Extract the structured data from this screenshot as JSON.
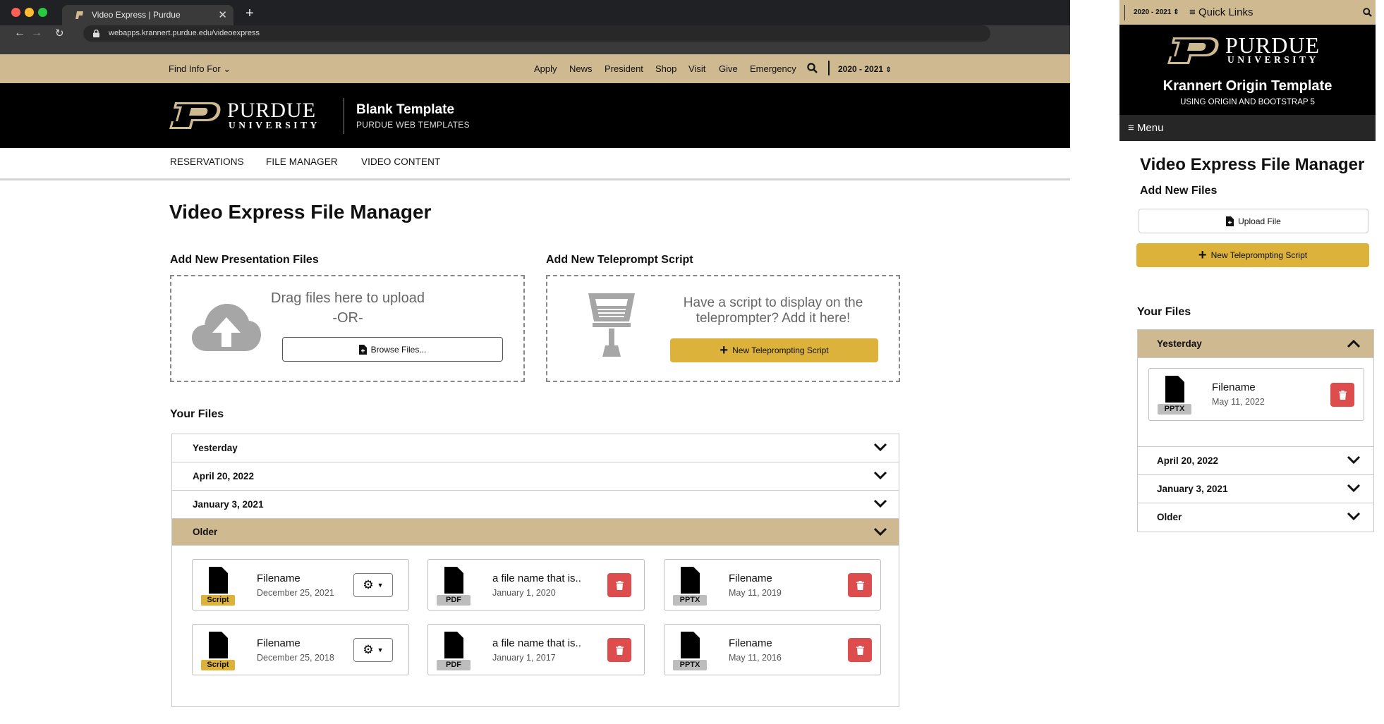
{
  "browser": {
    "tab_title": "Video Express | Purdue",
    "url": "webapps.krannert.purdue.edu/videoexpress"
  },
  "utility_bar": {
    "find_info": "Find Info For",
    "links": [
      "Apply",
      "News",
      "President",
      "Shop",
      "Visit",
      "Give",
      "Emergency"
    ],
    "year": "2020 - 2021"
  },
  "brand": {
    "wordmark_top": "PURDUE",
    "wordmark_bottom": "UNIVERSITY",
    "site_title": "Blank Template",
    "site_subtitle": "PURDUE WEB TEMPLATES"
  },
  "subnav": [
    "RESERVATIONS",
    "FILE MANAGER",
    "VIDEO CONTENT"
  ],
  "page_title": "Video Express File Manager",
  "presentation": {
    "heading": "Add New Presentation Files",
    "drag_text_1": "Drag files here to upload",
    "drag_text_2": "-OR-",
    "browse_label": "Browse Files..."
  },
  "teleprompt": {
    "heading": "Add New Teleprompt Script",
    "prompt_1": "Have a script to display on the",
    "prompt_2": "teleprompter? Add it here!",
    "new_label": "New Teleprompting Script"
  },
  "files": {
    "heading": "Your Files",
    "groups": [
      "Yesterday",
      "April 20, 2022",
      "January 3, 2021",
      "Older"
    ],
    "cards": [
      {
        "type": "Script",
        "name": "Filename",
        "date": "December 25, 2021"
      },
      {
        "type": "PDF",
        "name": "a file name that is..",
        "date": "January 1, 2020"
      },
      {
        "type": "PPTX",
        "name": "Filename",
        "date": "May 11, 2019"
      },
      {
        "type": "Script",
        "name": "Filename",
        "date": "December 25, 2018"
      },
      {
        "type": "PDF",
        "name": "a file name that is..",
        "date": "January 1, 2017"
      },
      {
        "type": "PPTX",
        "name": "Filename",
        "date": "May 11, 2016"
      }
    ]
  },
  "mobile": {
    "year": "2020 - 2021",
    "quick_links": "Quick Links",
    "wordmark_top": "PURDUE",
    "wordmark_bottom": "UNIVERSITY",
    "site_title": "Krannert Origin Template",
    "site_subtitle": "USING ORIGIN AND BOOTSTRAP 5",
    "menu": "Menu",
    "page_title": "Video Express File Manager",
    "add_heading": "Add New Files",
    "upload_label": "Upload File",
    "new_script_label": "New Teleprompting Script",
    "files_heading": "Your Files",
    "groups": [
      "Yesterday",
      "April 20, 2022",
      "January 3, 2021",
      "Older"
    ],
    "card": {
      "type": "PPTX",
      "name": "Filename",
      "date": "May 11, 2022"
    }
  },
  "colors": {
    "gold": "#cfb991",
    "button_gold": "#dcb23b",
    "danger": "#dd4d4d",
    "black": "#000000"
  }
}
